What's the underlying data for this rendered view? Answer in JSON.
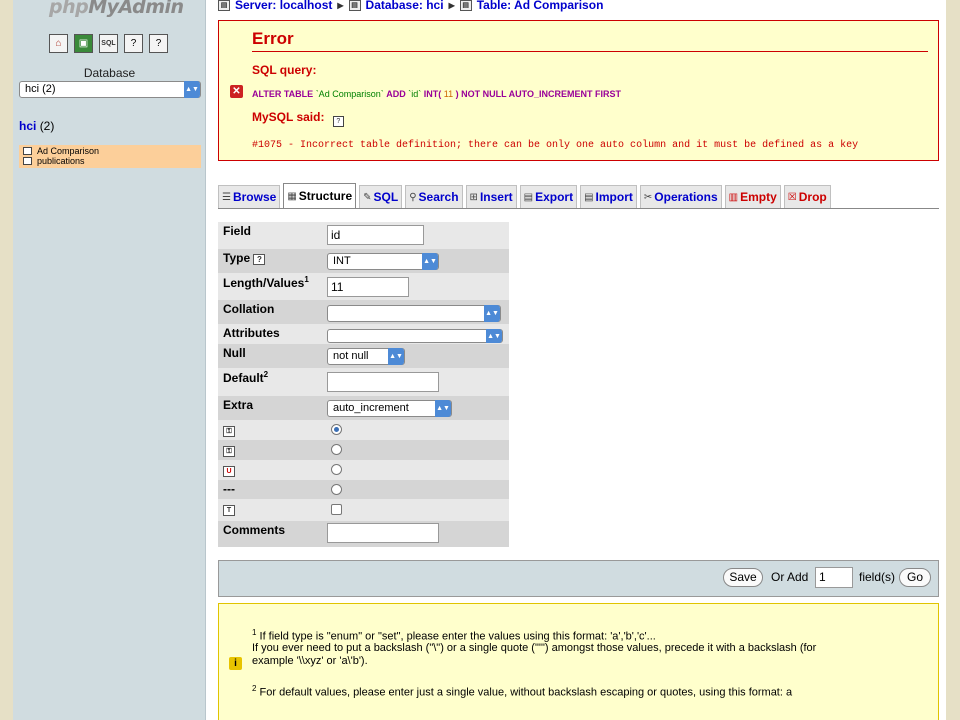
{
  "sidebar": {
    "logo_php": "php",
    "logo_myadmin": "MyAdmin",
    "db_label": "Database",
    "db_select": "hci (2)",
    "db_name": "hci",
    "db_count": "(2)",
    "tables": [
      "Ad Comparison",
      "publications"
    ]
  },
  "breadcrumb": {
    "server": "Server: localhost",
    "database": "Database: hci",
    "table": "Table: Ad Comparison"
  },
  "error": {
    "title": "Error",
    "sql_query_label": "SQL query:",
    "sql": {
      "alter": "ALTER TABLE",
      "table": "`Ad Comparison`",
      "add": "ADD",
      "col": "`id`",
      "int": "INT(",
      "num": "11",
      "rest": ") NOT NULL AUTO_INCREMENT FIRST"
    },
    "mysql_said_label": "MySQL said:",
    "message": "#1075 - Incorrect table definition; there can be only one auto column and it must be defined as a key"
  },
  "tabs": [
    {
      "label": "Browse",
      "icon": "browse-icon"
    },
    {
      "label": "Structure",
      "icon": "structure-icon"
    },
    {
      "label": "SQL",
      "icon": "sql-icon"
    },
    {
      "label": "Search",
      "icon": "search-icon"
    },
    {
      "label": "Insert",
      "icon": "insert-icon"
    },
    {
      "label": "Export",
      "icon": "export-icon"
    },
    {
      "label": "Import",
      "icon": "import-icon"
    },
    {
      "label": "Operations",
      "icon": "operations-icon"
    },
    {
      "label": "Empty",
      "icon": "empty-icon"
    },
    {
      "label": "Drop",
      "icon": "drop-icon"
    }
  ],
  "form": {
    "field_label": "Field",
    "field_value": "id",
    "type_label": "Type",
    "type_value": "INT",
    "length_label": "Length/Values",
    "length_value": "11",
    "collation_label": "Collation",
    "collation_value": "",
    "attributes_label": "Attributes",
    "attributes_value": "",
    "null_label": "Null",
    "null_value": "not null",
    "default_label": "Default",
    "default_value": "",
    "extra_label": "Extra",
    "extra_value": "auto_increment",
    "index_none_label": "---",
    "comments_label": "Comments",
    "comments_value": "",
    "sup1": "1",
    "sup2": "2"
  },
  "savebar": {
    "save": "Save",
    "or_add": "Or Add",
    "count": "1",
    "fields": "field(s)",
    "go": "Go"
  },
  "notes": {
    "sup1": "1",
    "line1": "If field type is \"enum\" or \"set\", please enter the values using this format: 'a','b','c'...",
    "line2": "If you ever need to put a backslash (\"\\\") or a single quote (\"'\") amongst those values, precede it with a backslash (for",
    "line3": "example '\\\\xyz' or 'a\\'b').",
    "sup2": "2",
    "line4": "For default values, please enter just a single value, without backslash escaping or quotes, using this format: a"
  }
}
